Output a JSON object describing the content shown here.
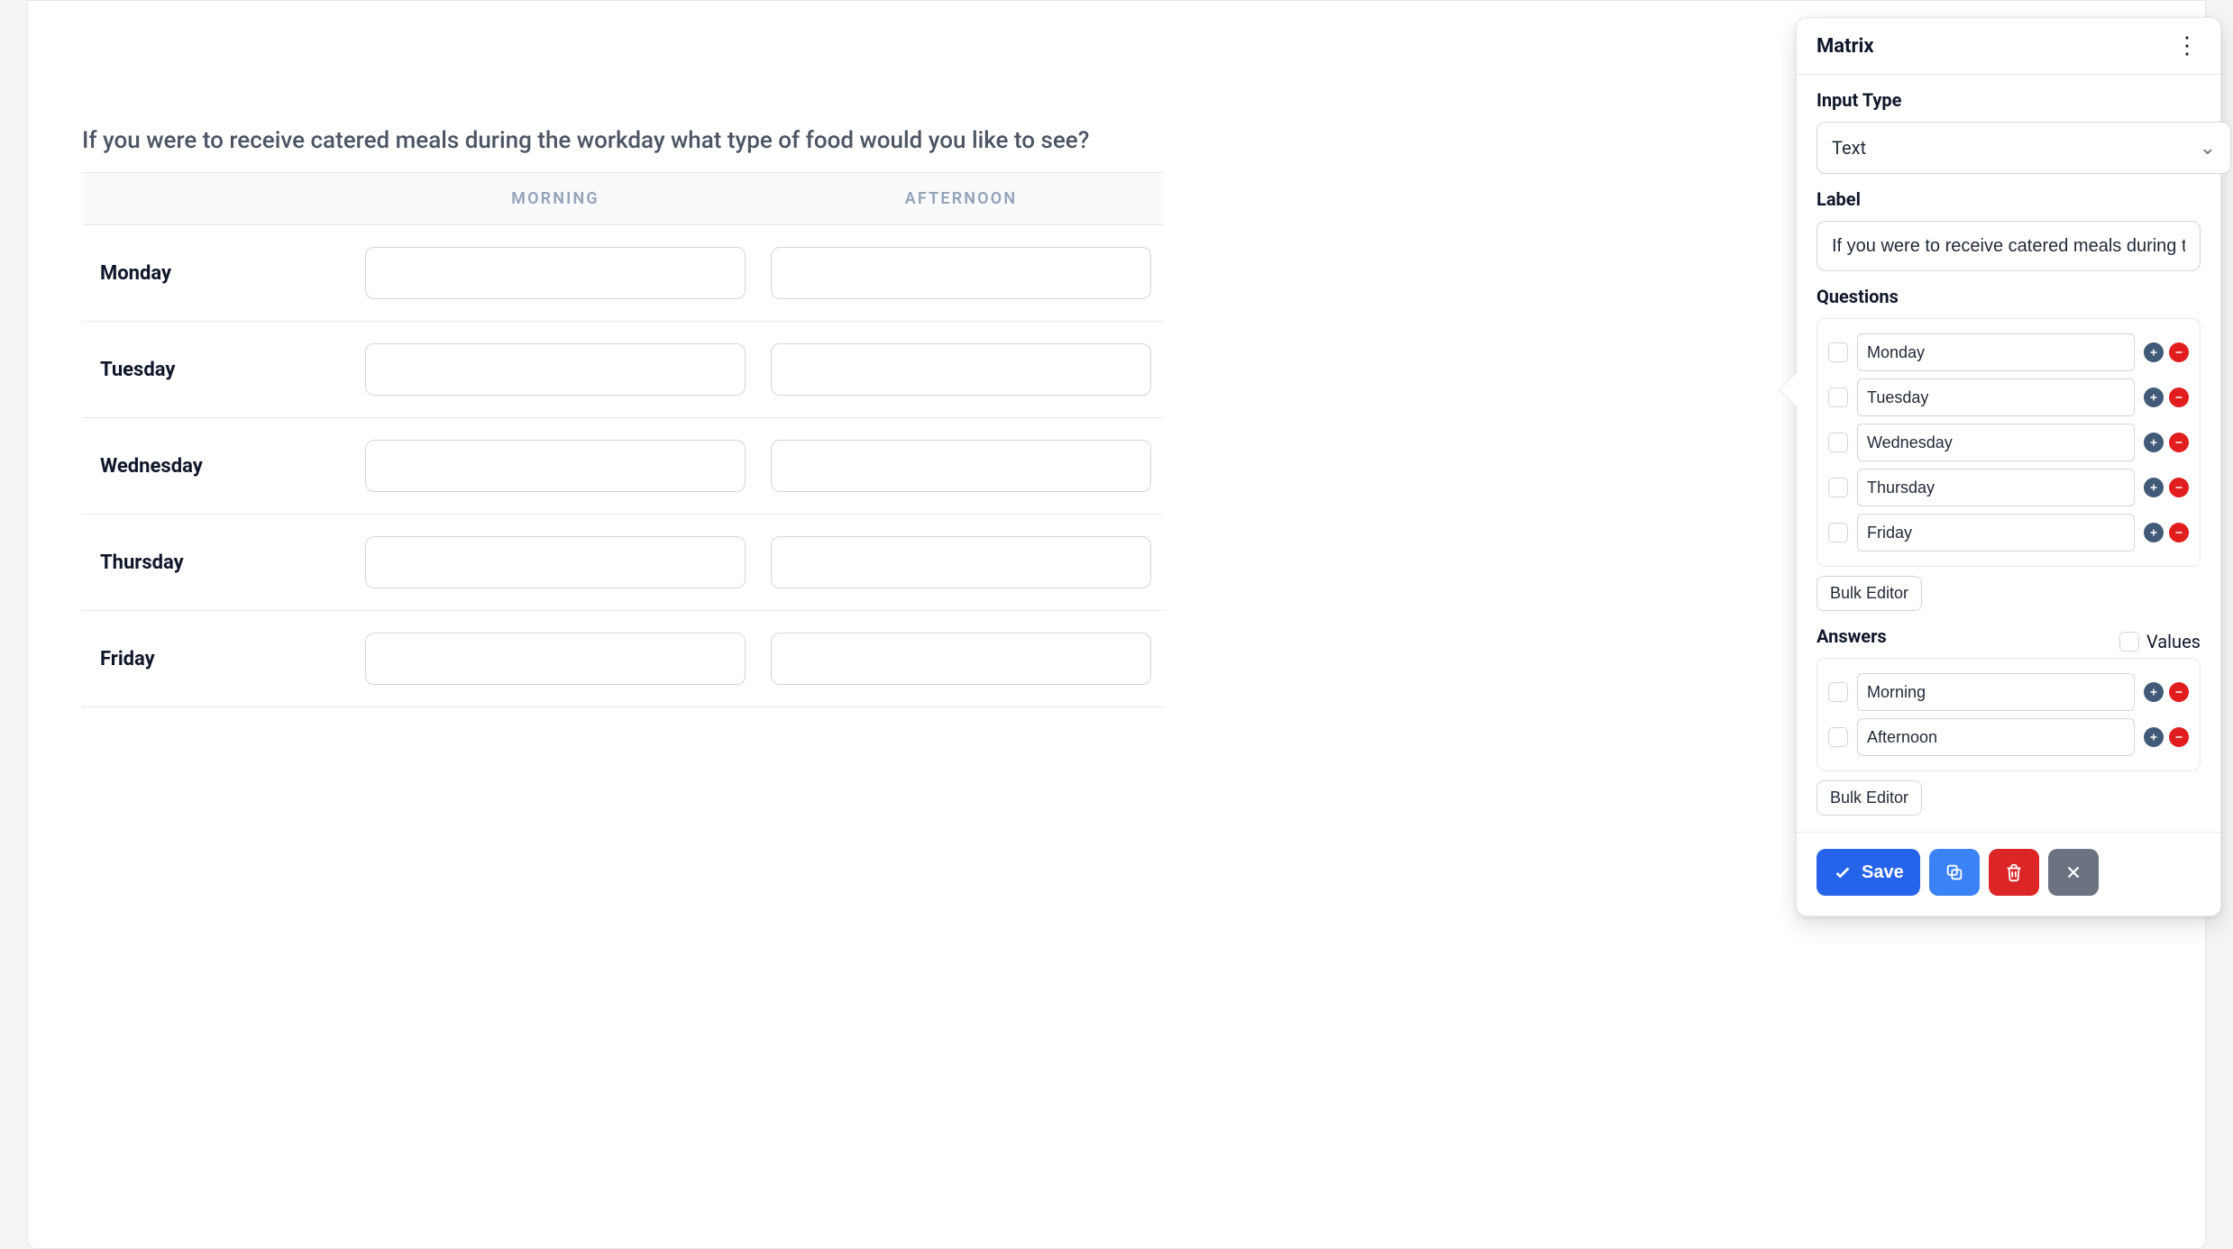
{
  "question": {
    "label": "If you were to receive catered meals during the workday what type of food would you like to see?",
    "columns": [
      "MORNING",
      "AFTERNOON"
    ],
    "rows": [
      "Monday",
      "Tuesday",
      "Wednesday",
      "Thursday",
      "Friday"
    ]
  },
  "panel": {
    "title": "Matrix",
    "inputType": {
      "label": "Input Type",
      "value": "Text"
    },
    "labelField": {
      "label": "Label",
      "value": "If you were to receive catered meals during the workday what type of food would you like to see?"
    },
    "questions": {
      "label": "Questions",
      "items": [
        "Monday",
        "Tuesday",
        "Wednesday",
        "Thursday",
        "Friday"
      ],
      "bulkEditor": "Bulk Editor"
    },
    "answers": {
      "label": "Answers",
      "valuesLabel": "Values",
      "items": [
        "Morning",
        "Afternoon"
      ],
      "bulkEditor": "Bulk Editor"
    },
    "buttons": {
      "save": "Save"
    }
  }
}
